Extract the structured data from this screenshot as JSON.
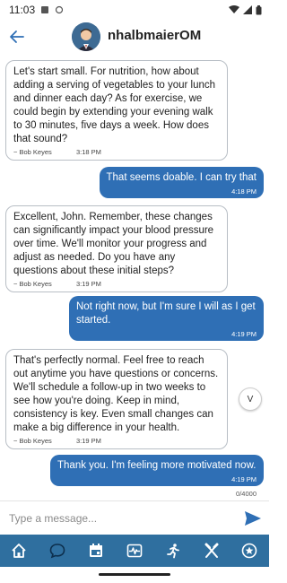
{
  "status": {
    "time": "11:03"
  },
  "header": {
    "title": "nhalbmaierOM"
  },
  "messages": [
    {
      "direction": "in",
      "text": "Let's start small. For nutrition, how about adding a serving of vegetables to your lunch and dinner each day? As for exercise, we could begin by extending your evening walk to 30 minutes, five days a week. How does that sound?",
      "sender": "~ Bob Keyes",
      "time": "3:18 PM"
    },
    {
      "direction": "out",
      "text": "That seems doable. I can try that",
      "time": "4:18 PM"
    },
    {
      "direction": "in",
      "text": "Excellent, John. Remember, these changes can significantly impact your blood pressure over time. We'll monitor your progress and adjust as needed. Do you have any questions about these initial steps?",
      "sender": "~ Bob Keyes",
      "time": "3:19 PM"
    },
    {
      "direction": "out",
      "text": "Not right now, but I'm sure I will as I get started.",
      "time": "4:19 PM"
    },
    {
      "direction": "in",
      "text": "That's perfectly normal. Feel free to reach out anytime you have questions or concerns. We'll schedule a follow-up in two weeks to see how you're doing. Keep in mind, consistency is key. Even small changes can make a big difference in your health.",
      "sender": "~ Bob Keyes",
      "time": "3:19 PM"
    },
    {
      "direction": "out",
      "text": "Thank you. I'm feeling more motivated now.",
      "time": "4:19 PM"
    }
  ],
  "scroll_down_label": "V",
  "composer": {
    "placeholder": "Type a message...",
    "char_count": "0/4000"
  },
  "nav": {
    "items": [
      {
        "icon": "home-icon"
      },
      {
        "icon": "chat-icon",
        "active": true
      },
      {
        "icon": "calendar-icon"
      },
      {
        "icon": "heart-rate-icon"
      },
      {
        "icon": "running-icon"
      },
      {
        "icon": "fork-knife-icon"
      },
      {
        "icon": "star-badge-icon"
      }
    ]
  },
  "colors": {
    "accent": "#2f6fb5",
    "nav_bg": "#2f6f9f"
  }
}
